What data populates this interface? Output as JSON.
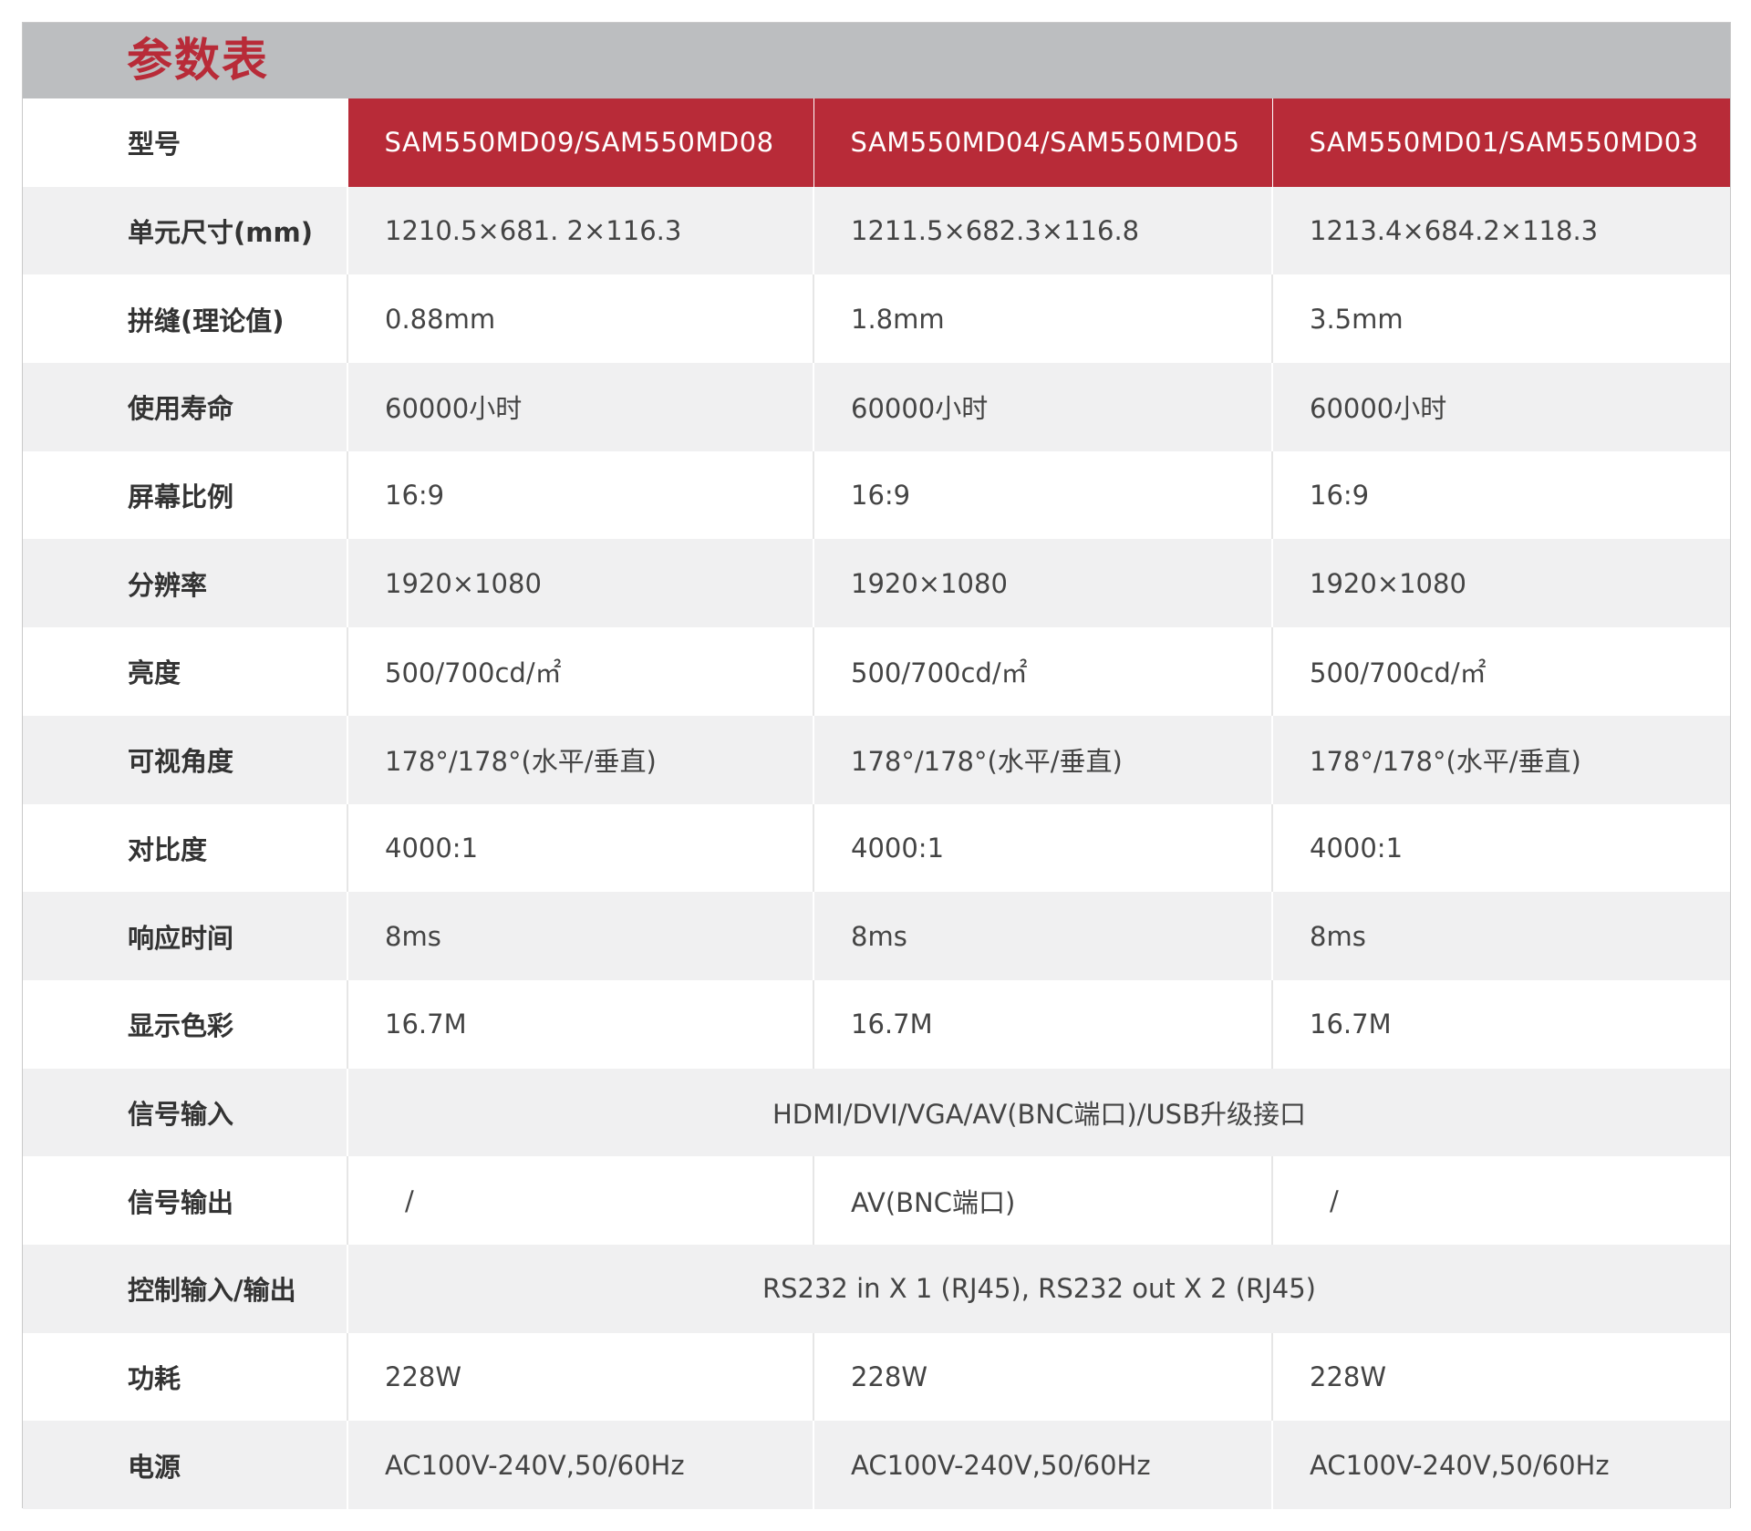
{
  "title": "参数表",
  "header": {
    "label": "型号",
    "models": [
      "SAM550MD09/SAM550MD08",
      "SAM550MD04/SAM550MD05",
      "SAM550MD01/SAM550MD03"
    ]
  },
  "rows": [
    {
      "label": "单元尺寸(mm)",
      "values": [
        "1210.5×681. 2×116.3",
        "1211.5×682.3×116.8",
        "1213.4×684.2×118.3"
      ]
    },
    {
      "label": "拼缝(理论值)",
      "values": [
        "0.88mm",
        "1.8mm",
        "3.5mm"
      ]
    },
    {
      "label": "使用寿命",
      "values": [
        "60000小时",
        "60000小时",
        "60000小时"
      ]
    },
    {
      "label": "屏幕比例",
      "values": [
        "16:9",
        "16:9",
        "16:9"
      ]
    },
    {
      "label": "分辨率",
      "values": [
        "1920×1080",
        "1920×1080",
        "1920×1080"
      ]
    },
    {
      "label": "亮度",
      "values": [
        "500/700cd/㎡",
        "500/700cd/㎡",
        "500/700cd/㎡"
      ]
    },
    {
      "label": "可视角度",
      "values": [
        "178°/178°(水平/垂直)",
        "178°/178°(水平/垂直)",
        "178°/178°(水平/垂直)"
      ]
    },
    {
      "label": "对比度",
      "values": [
        "4000:1",
        "4000:1",
        "4000:1"
      ]
    },
    {
      "label": "响应时间",
      "values": [
        "8ms",
        "8ms",
        "8ms"
      ]
    },
    {
      "label": "显示色彩",
      "values": [
        "16.7M",
        "16.7M",
        "16.7M"
      ]
    },
    {
      "label": "信号输入",
      "span": "HDMI/DVI/VGA/AV(BNC端口)/USB升级接口"
    },
    {
      "label": "信号输出",
      "values": [
        "/",
        "AV(BNC端口)",
        "/"
      ]
    },
    {
      "label": "控制输入/输出",
      "span": "RS232 in X 1 (RJ45), RS232 out X 2 (RJ45)"
    },
    {
      "label": "功耗",
      "values": [
        "228W",
        "228W",
        "228W"
      ]
    },
    {
      "label": "电源",
      "values": [
        "AC100V-240V,50/60Hz",
        "AC100V-240V,50/60Hz",
        "AC100V-240V,50/60Hz"
      ]
    }
  ]
}
